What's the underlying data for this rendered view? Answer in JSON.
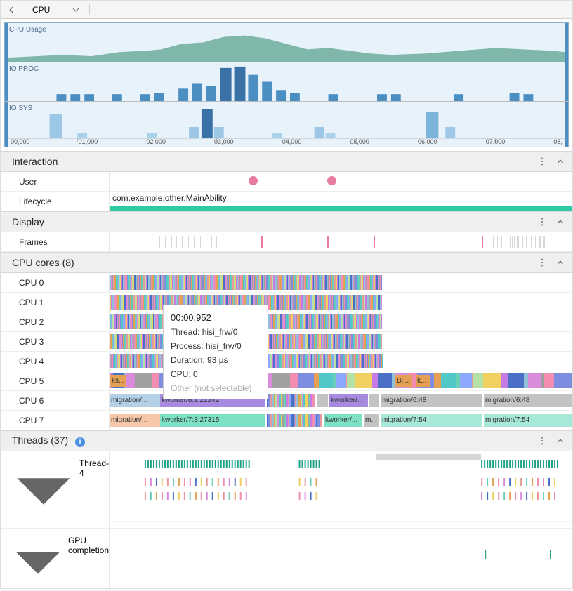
{
  "toolbar": {
    "selector_value": "CPU"
  },
  "timeline": {
    "tracks": [
      {
        "label": "CPU Usage"
      },
      {
        "label": "IO PROC"
      },
      {
        "label": "IO SYS"
      }
    ],
    "timestamps": [
      "00,000",
      "01,000",
      "02,000",
      "03,000",
      "04,000",
      "05,000",
      "06,000",
      "07,000",
      "08,"
    ]
  },
  "sections": {
    "interaction": {
      "title": "Interaction",
      "rows": {
        "user": {
          "label": "User"
        },
        "lifecycle": {
          "label": "Lifecycle",
          "text": "com.example.other.MainAbility"
        }
      }
    },
    "display": {
      "title": "Display",
      "frames_label": "Frames"
    },
    "cpu_cores": {
      "title": "CPU cores (8)",
      "cpus": [
        "CPU 0",
        "CPU 1",
        "CPU 2",
        "CPU 3",
        "CPU 4",
        "CPU 5",
        "CPU 6",
        "CPU 7"
      ],
      "cpu5_labels": {
        "ks": "ks...",
        "bi": "Bi...",
        "k": "k..."
      },
      "cpu6_labels": {
        "mig1": "migration/...",
        "kw1": "kworker/6:1:21242",
        "kw2": "kworker/...",
        "mig2": "migration/6:48",
        "mig3": "migration/6:48"
      },
      "cpu7_labels": {
        "mig1": "migration/...",
        "kw1": "kworker/7:3:27315",
        "kw2": "kworker/...",
        "m": "m...",
        "mig2": "migration/7:54",
        "mig3": "migration/7:54"
      }
    },
    "threads": {
      "title": "Threads (37)",
      "row1": "Thread-4",
      "row2": "GPU completion"
    }
  },
  "tooltip": {
    "time": "00:00,952",
    "thread": "Thread: hisi_frw/0",
    "process": "Process: hisi_frw/0",
    "duration": "Duration: 93 µs",
    "cpu": "CPU: 0",
    "other": "Other (not selectable)"
  },
  "colors": {
    "palette": [
      "#4a6fc7",
      "#7e8de0",
      "#e69b9b",
      "#8fc1d9",
      "#e6a054",
      "#b5e0a6",
      "#d98cd9",
      "#52c7c7",
      "#f0d060",
      "#a0a0a0",
      "#6ad0b5",
      "#c77ae6",
      "#f28cb0",
      "#8da8ff"
    ]
  }
}
